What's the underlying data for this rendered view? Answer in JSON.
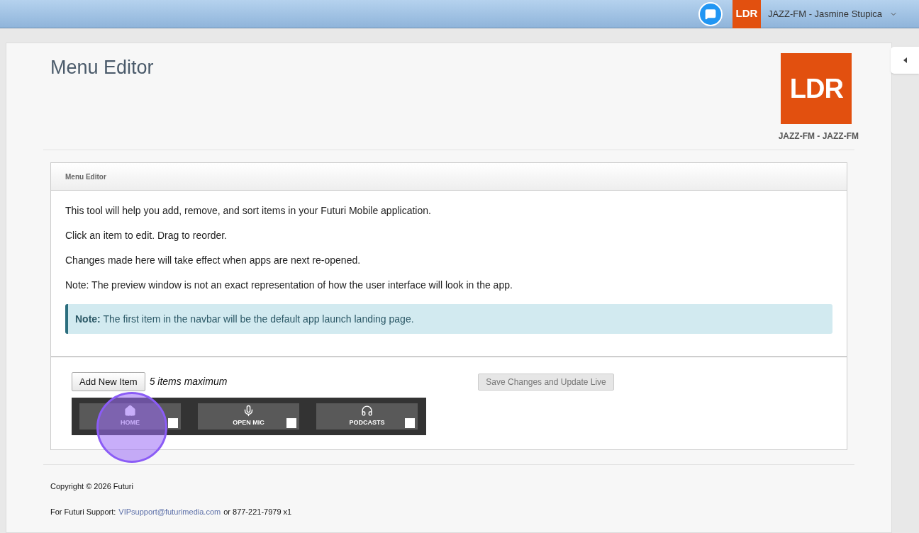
{
  "top_bar": {
    "logo": "LDR",
    "account": "JAZZ-FM - Jasmine Stupica"
  },
  "page": {
    "title": "Menu Editor",
    "logo": "LDR",
    "station": "JAZZ-FM - JAZZ-FM"
  },
  "panel": {
    "heading": "Menu Editor",
    "paragraphs": [
      "This tool will help you add, remove, and sort items in your Futuri Mobile application.",
      "Click an item to edit. Drag to reorder.",
      "Changes made here will take effect when apps are next re-opened.",
      "Note: The preview window is not an exact representation of how the user interface will look in the app."
    ],
    "note": "**Note:** The first item in the navbar will be the default app launch landing page.",
    "add_button": "Add New Item",
    "limit": "5 items maximum",
    "save_button": "Save Changes and Update Live",
    "nav_items": [
      {
        "label": "HOME",
        "kind": "home",
        "checked": false,
        "highlighted": true
      },
      {
        "label": "OPEN MIC",
        "kind": "mic",
        "checked": false,
        "highlighted": false
      },
      {
        "label": "PODCASTS",
        "kind": "headphones",
        "checked": false,
        "highlighted": false
      }
    ]
  },
  "footer": {
    "copyright": "Copyright © 2026 Futuri",
    "support_label": "For Futuri Support:",
    "email": "VIPsupport@futurimedia.com",
    "phone": "or 877-221-7979 x1"
  }
}
